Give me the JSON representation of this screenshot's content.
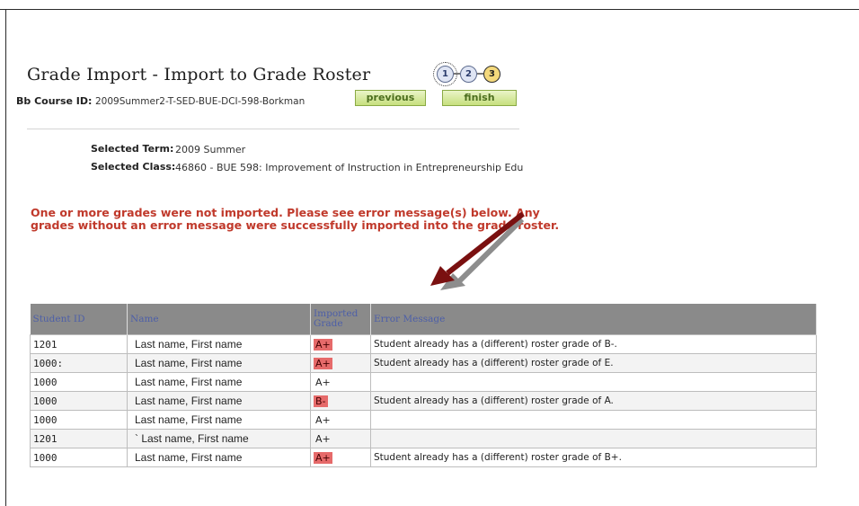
{
  "page": {
    "title": "Grade Import - Import to Grade Roster",
    "course_label": "Bb Course ID:",
    "course_value": "2009Summer2-T-SED-BUE-DCI-598-Borkman",
    "steps": [
      "1",
      "2",
      "3"
    ],
    "previous_label": "previous",
    "finish_label": "finish"
  },
  "selection": {
    "term_label": "Selected Term:",
    "term_value": "2009 Summer",
    "class_label": "Selected Class:",
    "class_value": "46860 - BUE 598: Improvement of Instruction in Entrepreneurship Edu"
  },
  "error_message": "One or more grades were not imported. Please see error message(s) below. Any grades without an error message were successfully imported into the grade roster.",
  "table": {
    "headers": [
      "Student ID",
      "Name",
      "Imported Grade",
      "Error Message"
    ],
    "rows": [
      {
        "id": "1201",
        "name": "Last name, First name",
        "grade": "A+",
        "error": true,
        "message": "Student already has a (different) roster grade of B-."
      },
      {
        "id": "1000:",
        "name": "Last name, First name",
        "grade": "A+",
        "error": true,
        "message": "Student already has a (different) roster grade of E."
      },
      {
        "id": "1000",
        "name": "Last name, First name",
        "grade": "A+",
        "error": false,
        "message": ""
      },
      {
        "id": "1000",
        "name": "Last name, First name",
        "grade": "B-",
        "error": true,
        "message": "Student already has a (different) roster grade of A."
      },
      {
        "id": "1000",
        "name": "Last name, First name",
        "grade": "A+",
        "error": false,
        "message": ""
      },
      {
        "id": "1201",
        "name": "` Last name, First name",
        "grade": "A+",
        "error": false,
        "message": ""
      },
      {
        "id": "1000",
        "name": "Last name, First name",
        "grade": "A+",
        "error": true,
        "message": "Student already has a (different) roster grade of B+."
      }
    ]
  },
  "colors": {
    "error_text": "#c0392b",
    "grade_error_highlight": "#e66a6a",
    "header_bg": "#8a8a8a",
    "header_text": "#4d5fa8",
    "button_text": "#4c6e1e"
  },
  "icons": {
    "arrow_dark": "arrow-dark-red-icon",
    "arrow_gray": "arrow-gray-icon"
  }
}
